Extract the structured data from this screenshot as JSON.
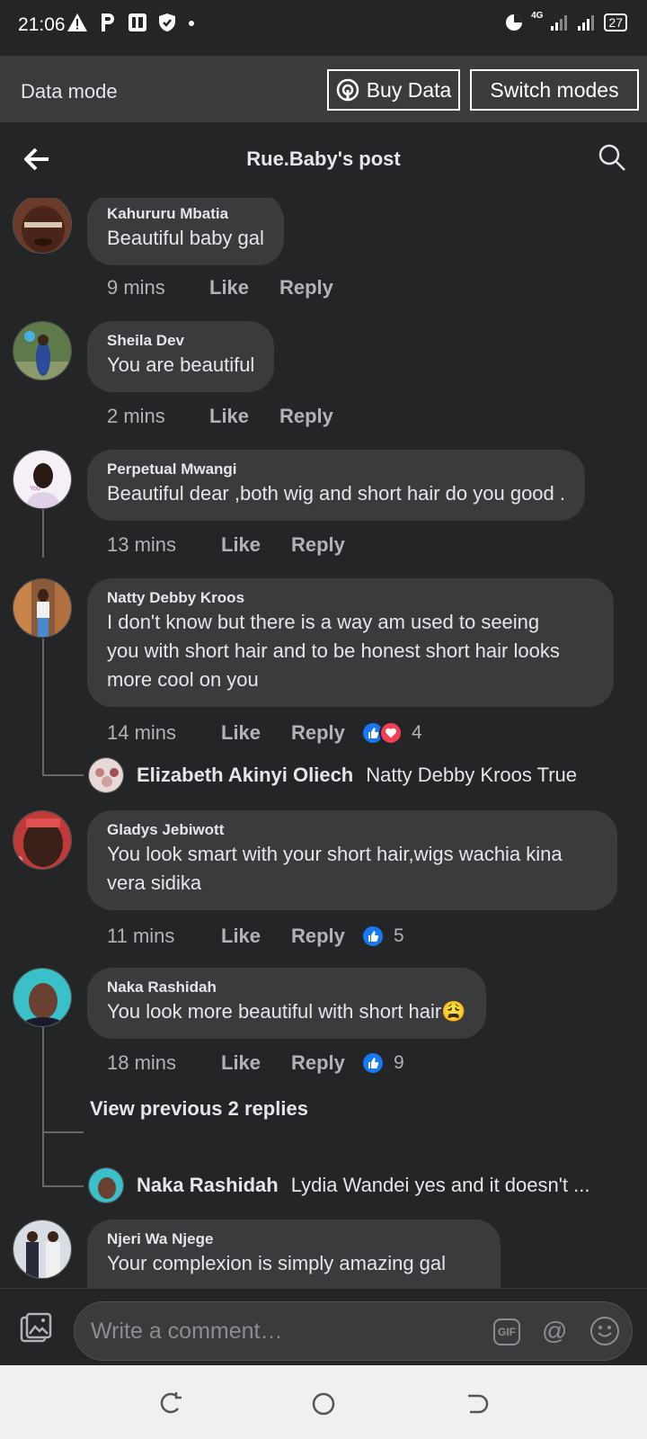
{
  "status_bar": {
    "time": "21:06",
    "network": "4G",
    "battery": "27"
  },
  "data_bar": {
    "label": "Data mode",
    "buy_data": "Buy Data",
    "switch_modes": "Switch modes"
  },
  "header": {
    "title": "Rue.Baby's post"
  },
  "comments": [
    {
      "author": "Kahururu Mbatia",
      "text": "Beautiful baby gal",
      "time": "9 mins",
      "like": "Like",
      "reply": "Reply"
    },
    {
      "author": "Sheila Dev",
      "text": "You are beautiful",
      "time": "2 mins",
      "like": "Like",
      "reply": "Reply"
    },
    {
      "author": "Perpetual Mwangi",
      "text": "Beautiful dear ,both wig and short hair do you good .",
      "time": "13 mins",
      "like": "Like",
      "reply": "Reply"
    },
    {
      "author": "Natty Debby Kroos",
      "text_lines": [
        "I don't know but there is a way am used to seeing",
        "you with short hair and to be honest short hair looks",
        "more cool on you"
      ],
      "time": "14 mins",
      "like": "Like",
      "reply": "Reply",
      "reactions": "4"
    },
    {
      "author": "Gladys Jebiwott",
      "text_lines": [
        "You look smart with your short hair,wigs wachia kina",
        "vera sidika"
      ],
      "time": "11 mins",
      "like": "Like",
      "reply": "Reply",
      "reactions": "5"
    },
    {
      "author": "Naka Rashidah",
      "text": "You look more beautiful with short hair",
      "emoji": "😩",
      "time": "18 mins",
      "like": "Like",
      "reply": "Reply",
      "reactions": "9"
    },
    {
      "author": "Njeri Wa Njege",
      "text": "Your complexion is simply amazing gal"
    }
  ],
  "replies": [
    {
      "author": "Elizabeth Akinyi Oliech",
      "text": "Natty Debby Kroos True"
    },
    {
      "author": "Naka Rashidah",
      "text": "Lydia Wandei yes and it doesn't ..."
    }
  ],
  "view_previous": "View previous 2 replies",
  "composer": {
    "placeholder": "Write a comment…",
    "gif": "GIF",
    "at": "@"
  },
  "colors": {
    "background": "#242526",
    "bubble": "#3a3b3c",
    "like_blue": "#1877f2",
    "love_red": "#f33e58"
  }
}
